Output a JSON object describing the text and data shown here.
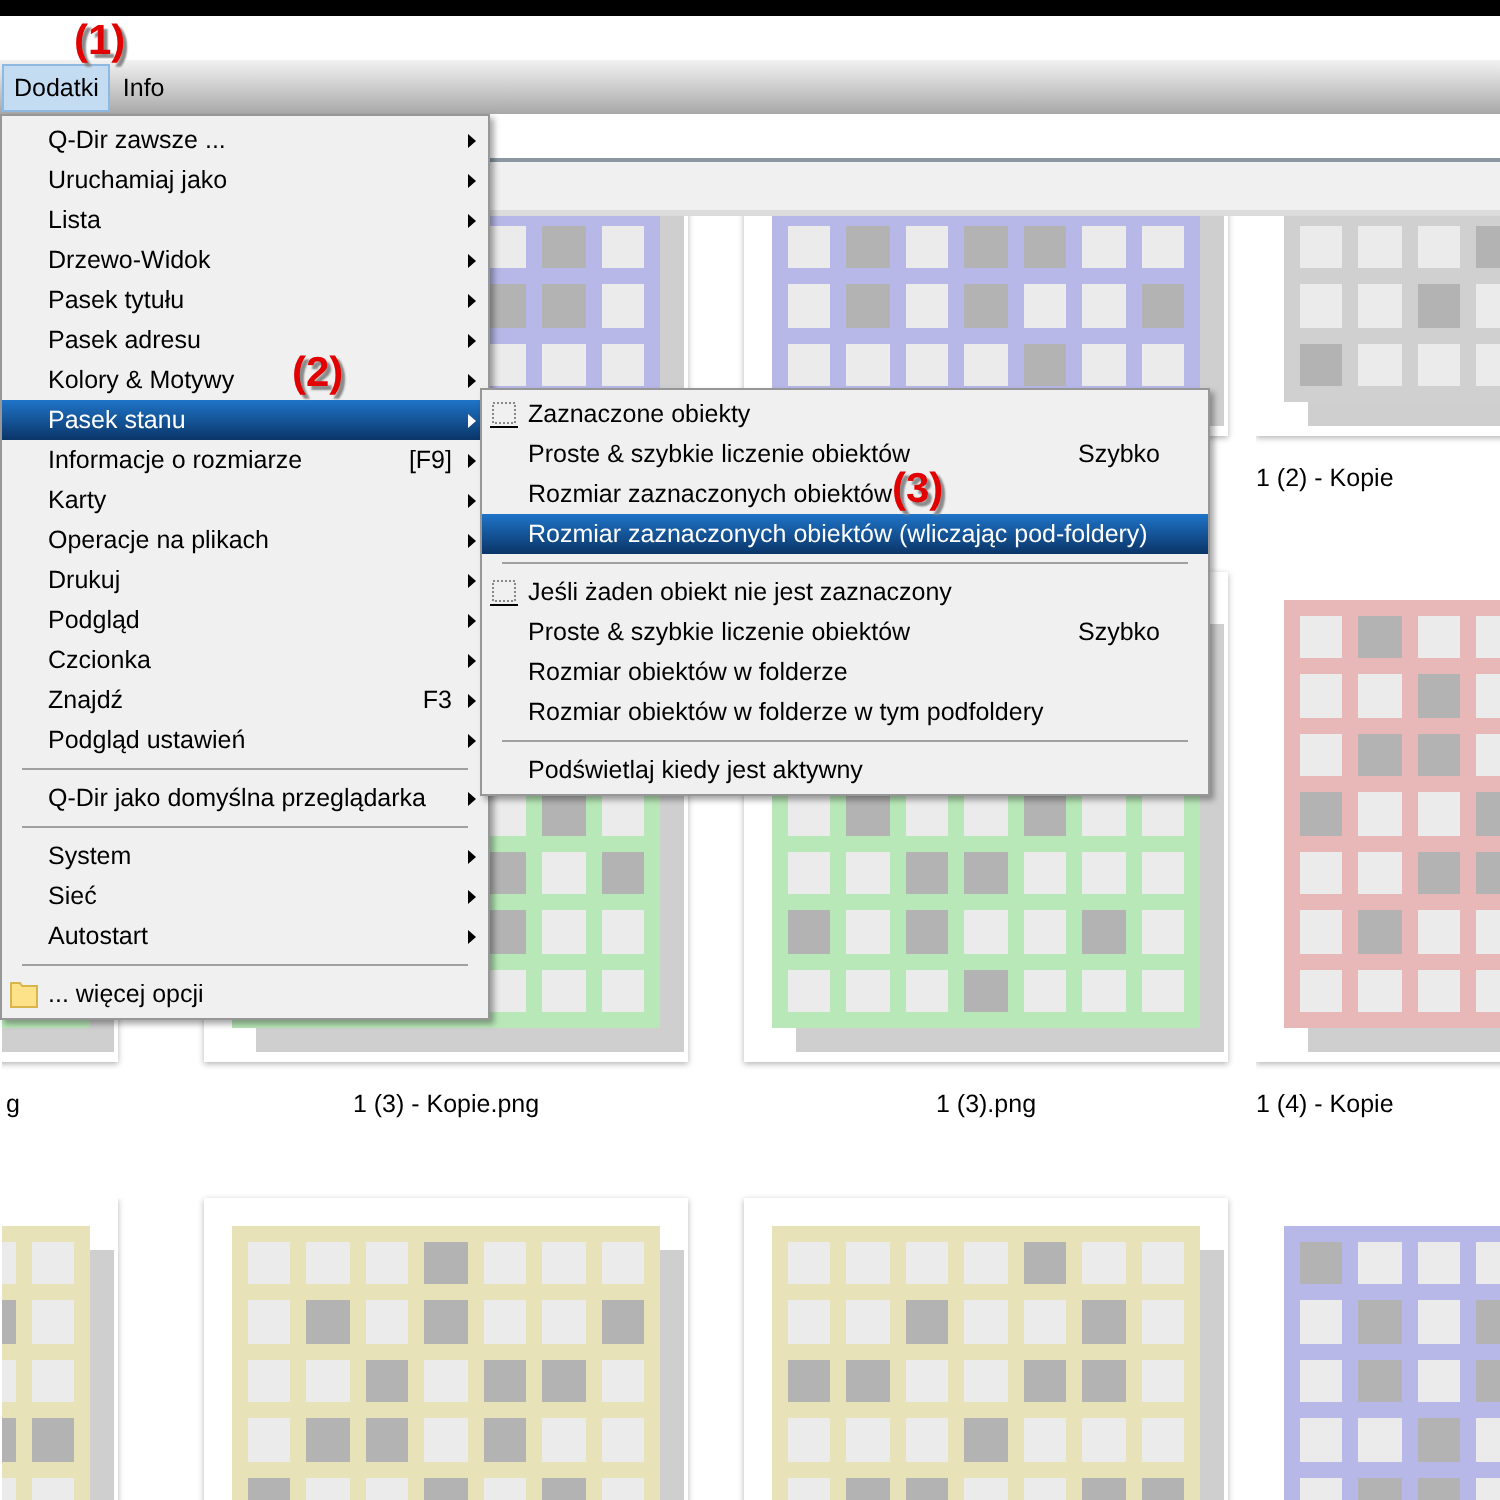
{
  "menubar": [
    {
      "label": "Dodatki",
      "selected": true
    },
    {
      "label": "Info",
      "selected": false
    }
  ],
  "menu": {
    "items": [
      {
        "kind": "item",
        "label": "Q-Dir zawsze ...",
        "submenu": true,
        "selected": false
      },
      {
        "kind": "item",
        "label": "Uruchamiaj jako",
        "submenu": true,
        "selected": false
      },
      {
        "kind": "item",
        "label": "Lista",
        "submenu": true,
        "selected": false
      },
      {
        "kind": "item",
        "label": "Drzewo-Widok",
        "submenu": true,
        "selected": false
      },
      {
        "kind": "item",
        "label": "Pasek tytułu",
        "submenu": true,
        "selected": false
      },
      {
        "kind": "item",
        "label": "Pasek adresu",
        "submenu": true,
        "selected": false
      },
      {
        "kind": "item",
        "label": "Kolory & Motywy",
        "submenu": true,
        "selected": false
      },
      {
        "kind": "item",
        "label": "Pasek stanu",
        "submenu": true,
        "selected": true
      },
      {
        "kind": "item",
        "label": "Informacje o rozmiarze",
        "shortcut": "[F9]",
        "submenu": true,
        "selected": false
      },
      {
        "kind": "item",
        "label": "Karty",
        "submenu": true,
        "selected": false
      },
      {
        "kind": "item",
        "label": "Operacje na plikach",
        "submenu": true,
        "selected": false
      },
      {
        "kind": "item",
        "label": "Drukuj",
        "submenu": true,
        "selected": false
      },
      {
        "kind": "item",
        "label": "Podgląd",
        "submenu": true,
        "selected": false
      },
      {
        "kind": "item",
        "label": "Czcionka",
        "submenu": true,
        "selected": false
      },
      {
        "kind": "item",
        "label": "Znajdź",
        "shortcut": "F3",
        "submenu": true,
        "selected": false
      },
      {
        "kind": "item",
        "label": "Podgląd ustawień",
        "submenu": true,
        "selected": false
      },
      {
        "kind": "separator"
      },
      {
        "kind": "item",
        "label": "Q-Dir jako domyślna przeglądarka",
        "submenu": true,
        "selected": false
      },
      {
        "kind": "separator"
      },
      {
        "kind": "item",
        "label": "System",
        "submenu": true,
        "selected": false
      },
      {
        "kind": "item",
        "label": "Sieć",
        "submenu": true,
        "selected": false
      },
      {
        "kind": "item",
        "label": "Autostart",
        "submenu": true,
        "selected": false
      },
      {
        "kind": "separator"
      },
      {
        "kind": "folder",
        "label": "... więcej opcji",
        "selected": false
      }
    ]
  },
  "submenu": {
    "items": [
      {
        "kind": "header",
        "label": "Zaznaczone obiekty",
        "selected": false
      },
      {
        "kind": "item",
        "label": "Proste & szybkie liczenie obiektów",
        "shortcut": "Szybko",
        "selected": false
      },
      {
        "kind": "item",
        "label": "Rozmiar zaznaczonych obiektów",
        "selected": false
      },
      {
        "kind": "item",
        "label": "Rozmiar zaznaczonych obiektów (wliczając pod-foldery)",
        "selected": true
      },
      {
        "kind": "separator"
      },
      {
        "kind": "header",
        "label": "Jeśli żaden obiekt nie jest zaznaczony",
        "selected": false
      },
      {
        "kind": "item",
        "label": "Proste & szybkie liczenie obiektów",
        "shortcut": "Szybko",
        "selected": false
      },
      {
        "kind": "item",
        "label": "Rozmiar obiektów w folderze",
        "selected": false
      },
      {
        "kind": "item",
        "label": "Rozmiar obiektów w folderze w tym podfoldery",
        "selected": false
      },
      {
        "kind": "separator"
      },
      {
        "kind": "item",
        "label": "Podświetlaj kiedy jest aktywny",
        "selected": false
      }
    ]
  },
  "files": {
    "rows": [
      {
        "tiles": [
          {
            "color": "#b8b8e8"
          },
          {
            "color": "#b8b8e8"
          },
          {
            "color": "#d0d0d0",
            "label": "1 (2) - Kopie"
          }
        ]
      },
      {
        "tiles": [
          {
            "color": "#b8e8b8",
            "label": "g",
            "cut": true
          },
          {
            "color": "#b8e8b8",
            "label": "1 (3) - Kopie.png"
          },
          {
            "color": "#b8e8b8",
            "label": "1 (3).png"
          },
          {
            "color": "#e8b8b8",
            "label": "1 (4) - Kopie"
          }
        ]
      },
      {
        "tiles": [
          {
            "color": "#e8e2b8",
            "cut": true
          },
          {
            "color": "#e8e2b8"
          },
          {
            "color": "#e8e2b8"
          },
          {
            "color": "#b8b8e8"
          }
        ]
      }
    ]
  },
  "annotations": [
    {
      "label": "(1)"
    },
    {
      "label": "(2)"
    },
    {
      "label": "(3)"
    }
  ]
}
